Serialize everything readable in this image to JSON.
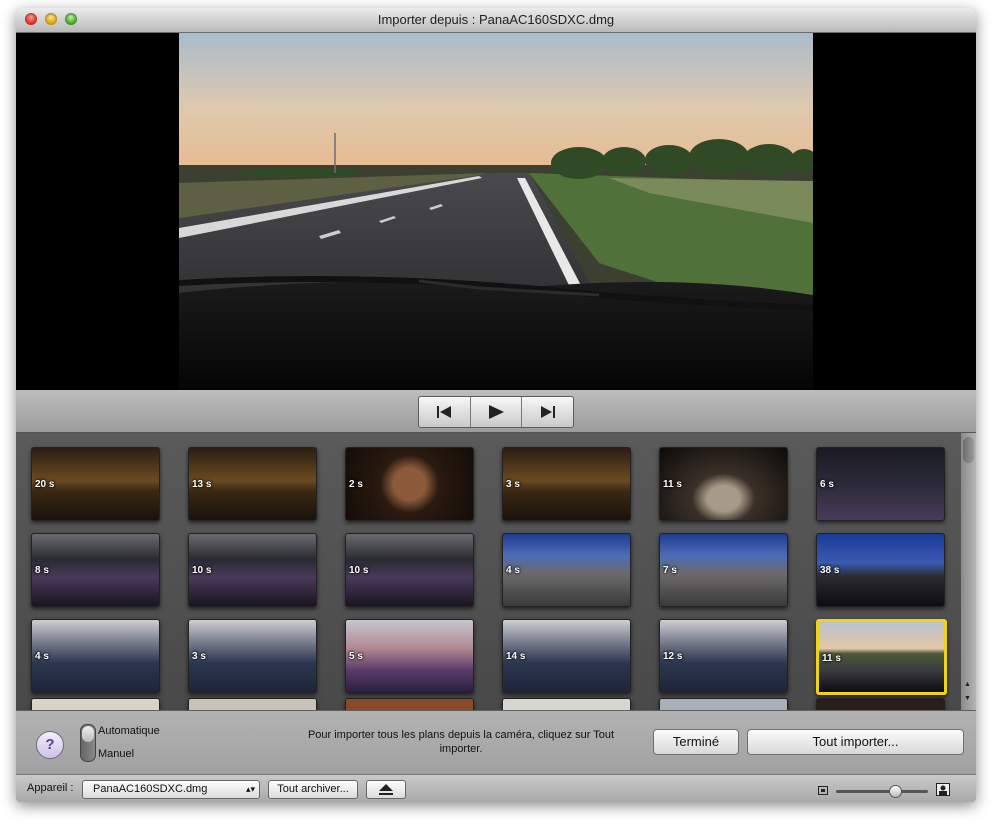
{
  "window": {
    "title": "Importer depuis : PanaAC160SDXC.dmg"
  },
  "transport": {
    "previous_icon": "skip-back-icon",
    "play_icon": "play-icon",
    "next_icon": "skip-forward-icon"
  },
  "clips": [
    {
      "duration": "20 s",
      "scene": "night-crowd"
    },
    {
      "duration": "13 s",
      "scene": "night-crowd"
    },
    {
      "duration": "2 s",
      "scene": "night-face"
    },
    {
      "duration": "3 s",
      "scene": "night-crowd"
    },
    {
      "duration": "11 s",
      "scene": "night-person"
    },
    {
      "duration": "6 s",
      "scene": "night-bus"
    },
    {
      "duration": "8 s",
      "scene": "bus-interior"
    },
    {
      "duration": "10 s",
      "scene": "bus-interior"
    },
    {
      "duration": "10 s",
      "scene": "bus-interior"
    },
    {
      "duration": "4 s",
      "scene": "dusk-street"
    },
    {
      "duration": "7 s",
      "scene": "dusk-street"
    },
    {
      "duration": "38 s",
      "scene": "dusk-road"
    },
    {
      "duration": "4 s",
      "scene": "bus-day"
    },
    {
      "duration": "3 s",
      "scene": "bus-day"
    },
    {
      "duration": "5 s",
      "scene": "bus-day-girl"
    },
    {
      "duration": "14 s",
      "scene": "bus-day"
    },
    {
      "duration": "12 s",
      "scene": "bus-day"
    },
    {
      "duration": "11 s",
      "scene": "highway"
    }
  ],
  "selected_clip_index": 17,
  "import_panel": {
    "help_label": "?",
    "mode_automatic": "Automatique",
    "mode_manual": "Manuel",
    "instructions": "Pour importer tous les plans depuis la caméra, cliquez sur Tout importer.",
    "done_button": "Terminé",
    "import_all_button": "Tout importer..."
  },
  "status_bar": {
    "device_label": "Appareil :",
    "device_value": "PanaAC160SDXC.dmg",
    "archive_button": "Tout archiver...",
    "eject_icon": "eject-icon",
    "zoom_small_icon": "small-thumb-icon",
    "zoom_large_icon": "large-thumb-icon"
  },
  "colors": {
    "selection": "#f1d21b",
    "window_bg": "#9b9b9b",
    "viewer_bg": "#000000"
  }
}
